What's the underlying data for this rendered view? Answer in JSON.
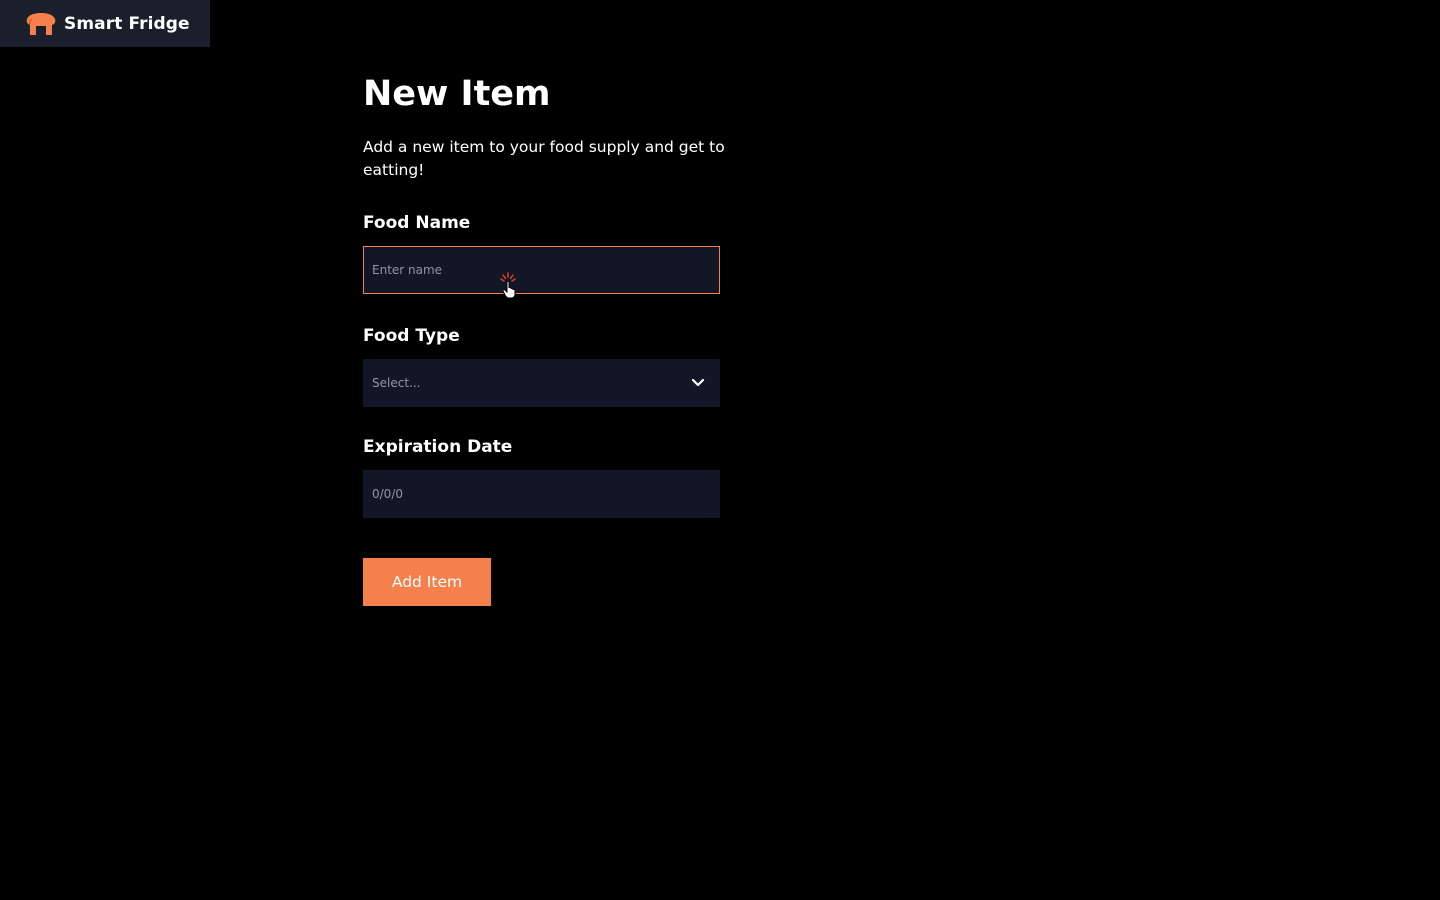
{
  "app": {
    "name": "Smart Fridge",
    "logo_icon": "bread-icon",
    "brand_color": "#f5804b"
  },
  "page": {
    "title": "New Item",
    "subtitle": "Add a new item to your food supply and get to eatting!"
  },
  "form": {
    "food_name": {
      "label": "Food Name",
      "value": "",
      "placeholder": "Enter name",
      "focused": true
    },
    "food_type": {
      "label": "Food Type",
      "selected": "Select...",
      "icon": "chevron-down-icon"
    },
    "expiration_date": {
      "label": "Expiration Date",
      "value": "",
      "placeholder": "0/0/0"
    },
    "submit_label": "Add Item"
  },
  "colors": {
    "background": "#000000",
    "header_bg": "#1b1f2b",
    "input_bg": "#121626",
    "accent": "#f5804b",
    "focus_border": "#f5804b"
  }
}
